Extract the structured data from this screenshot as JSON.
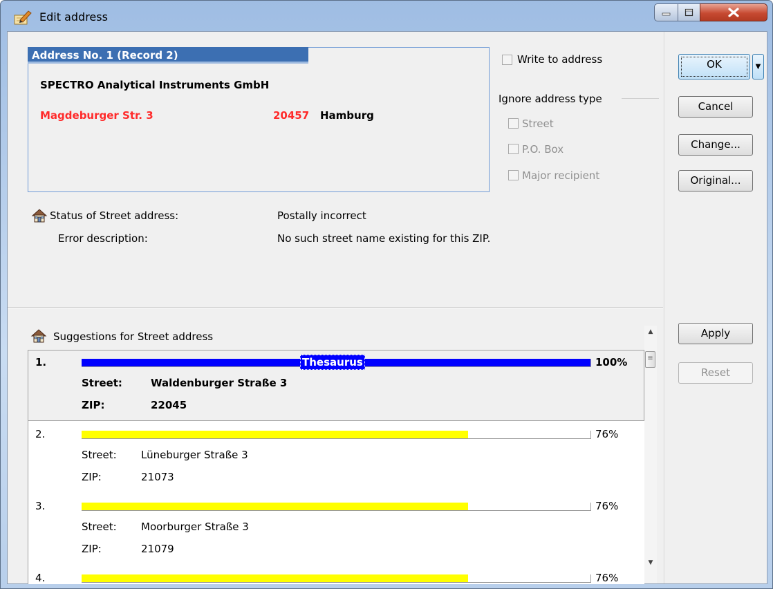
{
  "window": {
    "title": "Edit address",
    "min_icon": "minimize-icon",
    "max_icon": "maximize-icon",
    "close_icon": "close-icon"
  },
  "address": {
    "header": "Address No. 1 (Record 2)",
    "company": "SPECTRO Analytical Instruments GmbH",
    "street": "Magdeburger Str. 3",
    "zip": "20457",
    "city": "Hamburg",
    "error_color": "#ff2a2a"
  },
  "options": {
    "write_to_address": "Write to address",
    "ignore_group": "Ignore address type",
    "street": "Street",
    "po_box": "P.O. Box",
    "major_recipient": "Major recipient"
  },
  "status": {
    "label": "Status of Street address:",
    "value": "Postally incorrect",
    "error_label": "Error description:",
    "error_value": "No such street name existing for this ZIP."
  },
  "suggestions": {
    "title": "Suggestions for Street address",
    "street_label": "Street:",
    "zip_label": "ZIP:",
    "items": [
      {
        "num": "1.",
        "match": 1.0,
        "pct": "100%",
        "badge": "Thesaurus",
        "street": "Waldenburger Straße 3",
        "zip": "22045"
      },
      {
        "num": "2.",
        "match": 0.76,
        "pct": "76%",
        "street": "Lüneburger Straße 3",
        "zip": "21073"
      },
      {
        "num": "3.",
        "match": 0.76,
        "pct": "76%",
        "street": "Moorburger Straße 3",
        "zip": "21079"
      },
      {
        "num": "4.",
        "match": 0.76,
        "pct": "76%"
      }
    ]
  },
  "buttons": {
    "ok": "OK",
    "cancel": "Cancel",
    "change": "Change...",
    "original": "Original...",
    "apply": "Apply",
    "reset": "Reset"
  }
}
